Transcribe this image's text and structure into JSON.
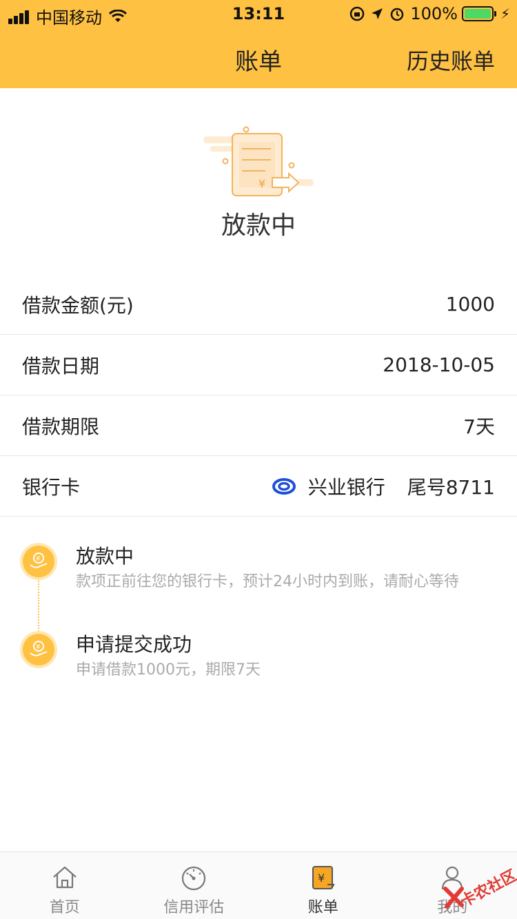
{
  "status_bar": {
    "carrier": "中国移动",
    "time": "13:11",
    "battery": "100%"
  },
  "nav": {
    "title": "账单",
    "right_action": "历史账单"
  },
  "hero": {
    "status": "放款中",
    "currency_symbol": "¥"
  },
  "details": [
    {
      "label": "借款金额(元)",
      "value": "1000"
    },
    {
      "label": "借款日期",
      "value": "2018-10-05"
    },
    {
      "label": "借款期限",
      "value": "7天"
    }
  ],
  "bank_card": {
    "label": "银行卡",
    "bank": "兴业银行",
    "tail": "尾号8711"
  },
  "timeline": [
    {
      "title": "放款中",
      "desc": "款项正前往您的银行卡，预计24小时内到账，请耐心等待"
    },
    {
      "title": "申请提交成功",
      "desc": "申请借款1000元，期限7天"
    }
  ],
  "tabs": [
    {
      "label": "首页",
      "icon": "home-icon"
    },
    {
      "label": "信用评估",
      "icon": "gauge-icon"
    },
    {
      "label": "账单",
      "icon": "bill-icon"
    },
    {
      "label": "我的",
      "icon": "user-icon"
    }
  ],
  "watermark": "卡农社区",
  "colors": {
    "brand": "#FFC142",
    "active_tab": "#F5A623"
  }
}
